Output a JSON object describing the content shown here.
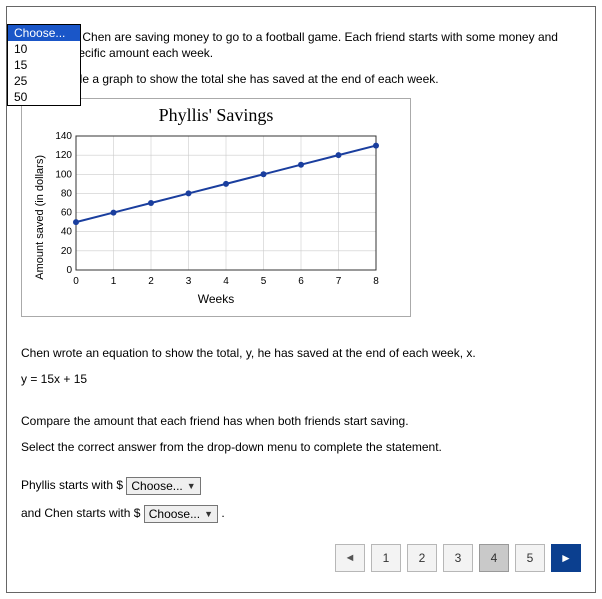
{
  "intro_p1": "Phyllis and Chen are saving money to go to a football game. Each friend starts with some money and saves a specific amount each week.",
  "intro_p2": "Phyllis made a graph to show the total she has saved at the end of each week.",
  "chen_line": "Chen wrote an equation to show the total, y, he has saved at the end of each week, x.",
  "equation": "y = 15x + 15",
  "compare_line": "Compare the amount that each friend has when both friends start saving.",
  "instruct_line": "Select the correct answer from the drop-down menu to complete the statement.",
  "sentence_a": "Phyllis starts with $",
  "sentence_b": " and Chen starts with $ ",
  "sentence_c": " .",
  "dropdown": {
    "placeholder": "Choose...",
    "options": [
      "Choose...",
      "10",
      "15",
      "25",
      "50"
    ]
  },
  "chart_data": {
    "type": "line",
    "title": "Phyllis' Savings",
    "xlabel": "Weeks",
    "ylabel": "Amount saved (in dollars)",
    "x": [
      0,
      1,
      2,
      3,
      4,
      5,
      6,
      7,
      8
    ],
    "y": [
      50,
      60,
      70,
      80,
      90,
      100,
      110,
      120,
      130
    ],
    "xlim": [
      0,
      8
    ],
    "ylim": [
      0,
      140
    ],
    "xticks": [
      0,
      1,
      2,
      3,
      4,
      5,
      6,
      7,
      8
    ],
    "yticks": [
      0,
      20,
      40,
      60,
      80,
      100,
      120,
      140
    ]
  },
  "pager": {
    "prev": "◄",
    "pages": [
      "1",
      "2",
      "3",
      "4",
      "5"
    ],
    "current": "4",
    "next": "►"
  }
}
